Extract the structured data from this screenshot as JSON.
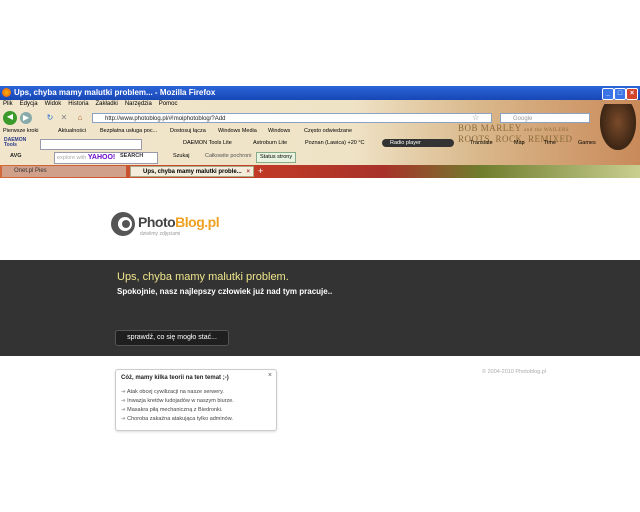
{
  "window": {
    "title": "Ups, chyba mamy malutki problem... - Mozilla Firefox",
    "controls": [
      "_",
      "□",
      "×"
    ]
  },
  "menu": [
    "Plik",
    "Edycja",
    "Widok",
    "Historia",
    "Zakładki",
    "Narzędzia",
    "Pomoc"
  ],
  "nav": {
    "url": "http://www.photoblog.pl/#!moiphotoblog/?Add",
    "search_placeholder": "Google"
  },
  "bookmarks": [
    "Pierwsze kroki",
    "Aktualności",
    "Bezpłatna usługa poc...",
    "Dostosuj łącza",
    "Windows Media",
    "Windows",
    "Często odwiedzane"
  ],
  "toolbar1": {
    "daemon_label": "DAEMON Tools",
    "daemon_lite": "DAEMON Tools Lite",
    "astroburn": "Astroburn Lite",
    "weather": "Poznan (Lawica) +20 °C",
    "radio": "Radio player",
    "translate": "Translate",
    "map": "Map",
    "time": "Time",
    "games": "Games"
  },
  "toolbar2": {
    "avg": "AVG",
    "yahoo_placeholder": "explore with",
    "yahoo_logo": "YAHOO!",
    "search_btn": "SEARCH",
    "szukaj": "Szukaj",
    "safe": "Całkowite pochroni",
    "status": "Status strony"
  },
  "banner": {
    "line1": "BOB MARLEY",
    "line1b": "and the WAILERS",
    "line2": "ROOTS, ROCK, REMIXED"
  },
  "tabs": [
    {
      "label": "Onet.pl Pies",
      "active": false
    },
    {
      "label": "Ups, chyba mamy malutki proble...",
      "active": true
    }
  ],
  "logo": {
    "photo": "Photo",
    "blog": "Blog",
    "pl": ".pl",
    "tagline": "dzielimy zdjęciami"
  },
  "error": {
    "title": "Ups, chyba mamy malutki problem.",
    "subtitle": "Spokojnie, nasz najlepszy człowiek już nad tym pracuje..",
    "check_button": "sprawdź, co się mogło stać..."
  },
  "copyright": "© 2004-2010 Photoblog.pl",
  "theories": {
    "title": "Cóż, mamy kilka teorii na ten temat ;-)",
    "close": "×",
    "items": [
      "Atak obcej cywilizacji na nasze serwery.",
      "Inwazja kretów ludojadów w naszym biurze.",
      "Masakra piłą mechaniczną z Biedronki.",
      "Choroba zakaźna atakująca tylko adminów."
    ]
  }
}
